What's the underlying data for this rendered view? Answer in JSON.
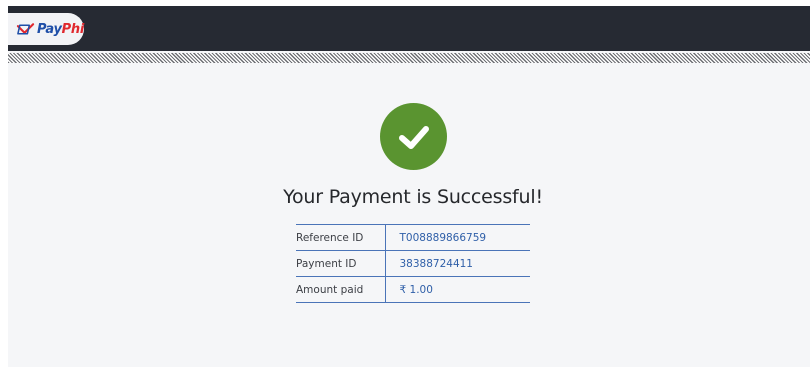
{
  "brand": {
    "pay": "Pay",
    "phi": "Phi"
  },
  "colors": {
    "topbar": "#262a33",
    "success": "#5a9430",
    "accent": "#2f5fa8",
    "brand_red": "#e0282e",
    "brand_blue": "#1f4fa8"
  },
  "status": {
    "icon": "check-circle-icon",
    "title": "Your Payment is Successful!"
  },
  "details": [
    {
      "label": "Reference ID",
      "value": "T008889866759"
    },
    {
      "label": "Payment ID",
      "value": "38388724411"
    },
    {
      "label": "Amount paid",
      "value": "₹ 1.00"
    }
  ]
}
